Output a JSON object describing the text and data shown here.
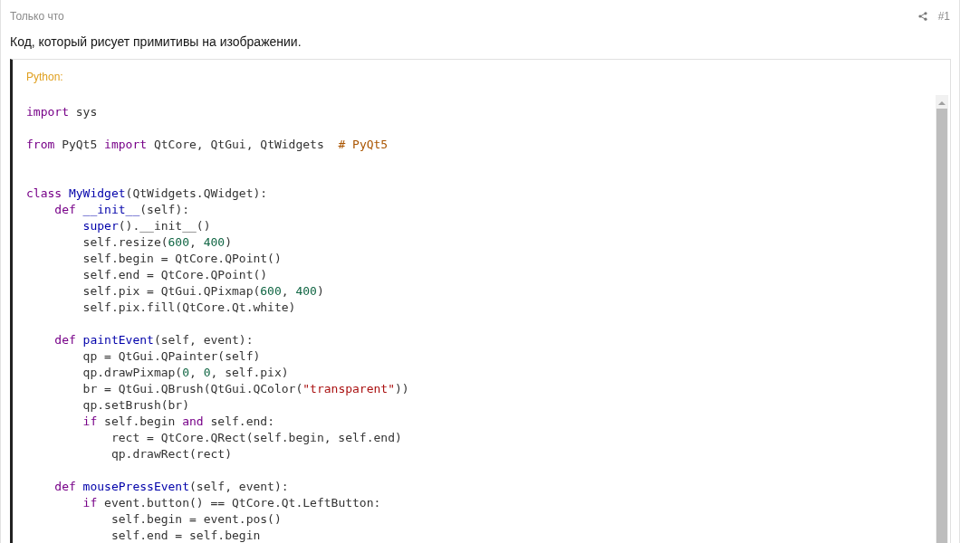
{
  "post": {
    "time": "Только что",
    "number": "#1",
    "text": "Код, который рисует примитивы на изображении."
  },
  "code_block": {
    "language": "Python:",
    "lines": [
      {
        "kind": "code",
        "tokens": [
          {
            "kind": "kw",
            "text": "import"
          },
          {
            "kind": "plain",
            "text": " sys"
          }
        ]
      },
      {
        "kind": "blank"
      },
      {
        "kind": "code",
        "tokens": [
          {
            "kind": "kw",
            "text": "from"
          },
          {
            "kind": "plain",
            "text": " PyQt5 "
          },
          {
            "kind": "kw",
            "text": "import"
          },
          {
            "kind": "plain",
            "text": " QtCore, QtGui, QtWidgets  "
          },
          {
            "kind": "com",
            "text": "# PyQt5"
          }
        ]
      },
      {
        "kind": "blank"
      },
      {
        "kind": "blank"
      },
      {
        "kind": "code",
        "tokens": [
          {
            "kind": "kw",
            "text": "class"
          },
          {
            "kind": "fn",
            "text": " MyWidget"
          },
          {
            "kind": "plain",
            "text": "(QtWidgets.QWidget):"
          }
        ]
      },
      {
        "kind": "code",
        "tokens": [
          {
            "kind": "kw",
            "text": "    def"
          },
          {
            "kind": "fn",
            "text": " __init__"
          },
          {
            "kind": "plain",
            "text": "(self):"
          }
        ]
      },
      {
        "kind": "code",
        "tokens": [
          {
            "kind": "fn",
            "text": "        super"
          },
          {
            "kind": "plain",
            "text": "().__init__()"
          }
        ]
      },
      {
        "kind": "code",
        "tokens": [
          {
            "kind": "plain",
            "text": "        self.resize("
          },
          {
            "kind": "num",
            "text": "600"
          },
          {
            "kind": "plain",
            "text": ", "
          },
          {
            "kind": "num",
            "text": "400"
          },
          {
            "kind": "plain",
            "text": ")"
          }
        ]
      },
      {
        "kind": "code",
        "tokens": [
          {
            "kind": "plain",
            "text": "        self.begin = QtCore.QPoint()"
          }
        ]
      },
      {
        "kind": "code",
        "tokens": [
          {
            "kind": "plain",
            "text": "        self.end = QtCore.QPoint()"
          }
        ]
      },
      {
        "kind": "code",
        "tokens": [
          {
            "kind": "plain",
            "text": "        self.pix = QtGui.QPixmap("
          },
          {
            "kind": "num",
            "text": "600"
          },
          {
            "kind": "plain",
            "text": ", "
          },
          {
            "kind": "num",
            "text": "400"
          },
          {
            "kind": "plain",
            "text": ")"
          }
        ]
      },
      {
        "kind": "code",
        "tokens": [
          {
            "kind": "plain",
            "text": "        self.pix.fill(QtCore.Qt.white)"
          }
        ]
      },
      {
        "kind": "blank"
      },
      {
        "kind": "code",
        "tokens": [
          {
            "kind": "kw",
            "text": "    def"
          },
          {
            "kind": "fn",
            "text": " paintEvent"
          },
          {
            "kind": "plain",
            "text": "(self, event):"
          }
        ]
      },
      {
        "kind": "code",
        "tokens": [
          {
            "kind": "plain",
            "text": "        qp = QtGui.QPainter(self)"
          }
        ]
      },
      {
        "kind": "code",
        "tokens": [
          {
            "kind": "plain",
            "text": "        qp.drawPixmap("
          },
          {
            "kind": "num",
            "text": "0"
          },
          {
            "kind": "plain",
            "text": ", "
          },
          {
            "kind": "num",
            "text": "0"
          },
          {
            "kind": "plain",
            "text": ", self.pix)"
          }
        ]
      },
      {
        "kind": "code",
        "tokens": [
          {
            "kind": "plain",
            "text": "        br = QtGui.QBrush(QtGui.QColor("
          },
          {
            "kind": "str",
            "text": "\"transparent\""
          },
          {
            "kind": "plain",
            "text": "))"
          }
        ]
      },
      {
        "kind": "code",
        "tokens": [
          {
            "kind": "plain",
            "text": "        qp.setBrush(br)"
          }
        ]
      },
      {
        "kind": "code",
        "tokens": [
          {
            "kind": "kw",
            "text": "        if"
          },
          {
            "kind": "plain",
            "text": " self.begin "
          },
          {
            "kind": "kw",
            "text": "and"
          },
          {
            "kind": "plain",
            "text": " self.end:"
          }
        ]
      },
      {
        "kind": "code",
        "tokens": [
          {
            "kind": "plain",
            "text": "            rect = QtCore.QRect(self.begin, self.end)"
          }
        ]
      },
      {
        "kind": "code",
        "tokens": [
          {
            "kind": "plain",
            "text": "            qp.drawRect(rect)"
          }
        ]
      },
      {
        "kind": "blank"
      },
      {
        "kind": "code",
        "tokens": [
          {
            "kind": "kw",
            "text": "    def"
          },
          {
            "kind": "fn",
            "text": " mousePressEvent"
          },
          {
            "kind": "plain",
            "text": "(self, event):"
          }
        ]
      },
      {
        "kind": "code",
        "tokens": [
          {
            "kind": "kw",
            "text": "        if"
          },
          {
            "kind": "plain",
            "text": " event.button() == QtCore.Qt.LeftButton:"
          }
        ]
      },
      {
        "kind": "code",
        "tokens": [
          {
            "kind": "plain",
            "text": "            self.begin = event.pos()"
          }
        ]
      },
      {
        "kind": "code",
        "tokens": [
          {
            "kind": "plain",
            "text": "            self.end = self.begin"
          }
        ]
      }
    ]
  }
}
